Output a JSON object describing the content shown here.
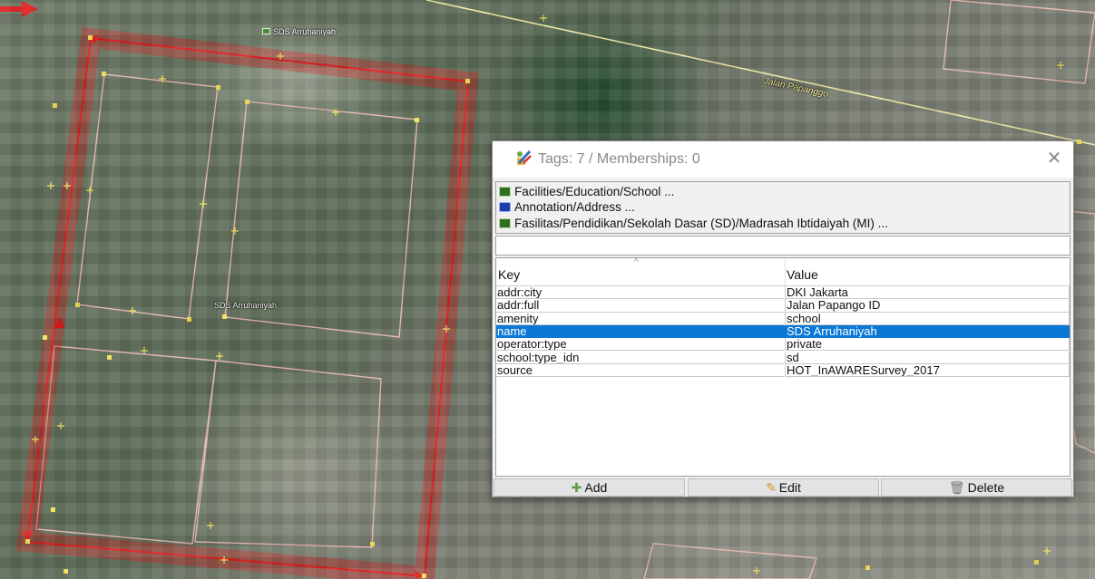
{
  "map": {
    "school_label_top": "SDS Arruhaniyah",
    "school_label_center": "SDS Arruhaniyah",
    "street_label": "Jalan Papanggo"
  },
  "dialog": {
    "title": "Tags: 7 / Memberships: 0",
    "close_icon": "close-icon",
    "presets": [
      {
        "label": "Facilities/Education/School ...",
        "icon": "school-icon"
      },
      {
        "label": "Annotation/Address ...",
        "icon": "address-icon"
      },
      {
        "label": "Fasilitas/Pendidikan/Sekolah Dasar (SD)/Madrasah Ibtidaiyah (MI) ...",
        "icon": "school-icon"
      }
    ],
    "filter": {
      "value": ""
    },
    "table": {
      "columns": [
        "Key",
        "Value"
      ],
      "rows": [
        {
          "key": "addr:city",
          "value": "DKI Jakarta"
        },
        {
          "key": "addr:full",
          "value": "Jalan Papango ID"
        },
        {
          "key": "amenity",
          "value": "school"
        },
        {
          "key": "name",
          "value": "SDS Arruhaniyah",
          "selected": true
        },
        {
          "key": "operator:type",
          "value": "private"
        },
        {
          "key": "school:type_idn",
          "value": "sd"
        },
        {
          "key": "source",
          "value": "HOT_InAWARESurvey_2017"
        }
      ]
    },
    "buttons": {
      "add": "Add",
      "edit": "Edit",
      "delete": "Delete"
    }
  },
  "colors": {
    "selection": "#0a78d7",
    "outline_red": "#e21b1b",
    "road_yellow": "#f2e9a8"
  }
}
